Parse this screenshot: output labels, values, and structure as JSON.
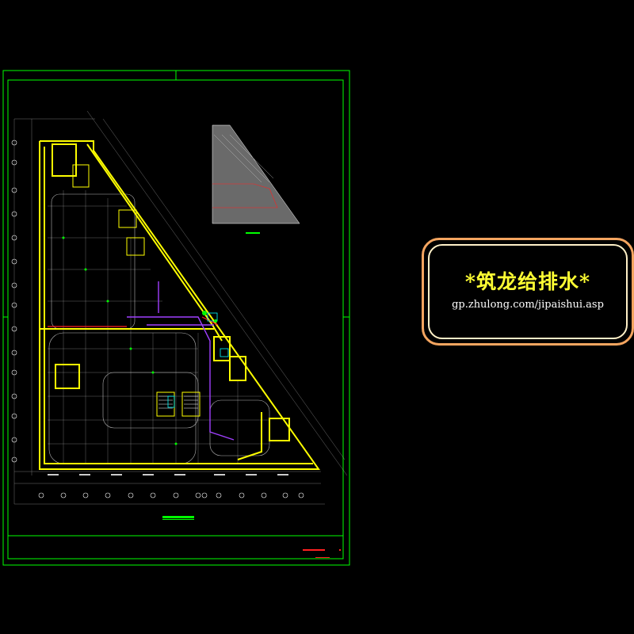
{
  "colors": {
    "frame": "#00ff00",
    "wall": "#ffff00",
    "pipe_red": "#ff2020",
    "pipe_purple": "#a040ff",
    "dim_line": "#ffffff",
    "room": "#00ffff",
    "stamp_border": "#f4a560",
    "stamp_title": "#ffff33"
  },
  "watermark": {
    "title": "*筑龙给排水*",
    "url": "gp.zhulong.com/jipaishui.asp"
  },
  "drawing": {
    "plan_caption": "",
    "key_plan_caption": "",
    "title_block_text": ""
  }
}
